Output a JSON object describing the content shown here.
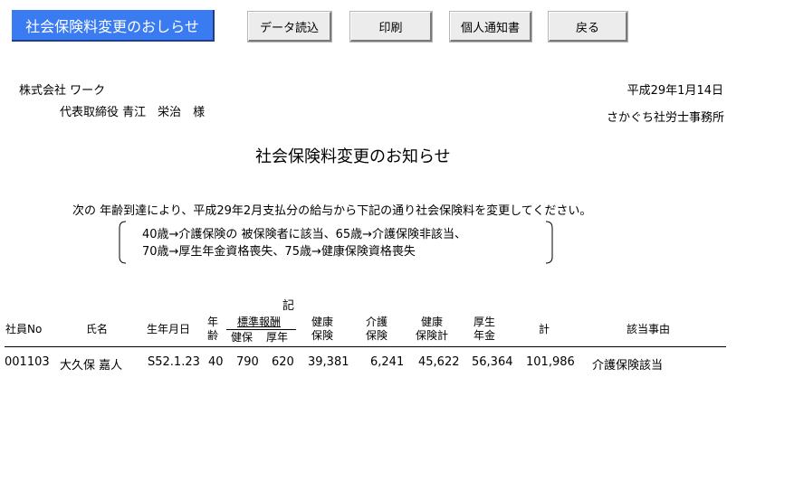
{
  "toolbar": {
    "title_badge": "社会保険料変更のおしらせ",
    "buttons": {
      "data_load": "データ読込",
      "print": "印刷",
      "individual_notice": "個人通知書",
      "back": "戻る"
    }
  },
  "letter": {
    "recipient_company": "株式会社 ワーク",
    "recipient_person": "代表取締役 青江　栄治　様",
    "date": "平成29年1月14日",
    "sender": "さかぐち社労士事務所",
    "title": "社会保険料変更のお知らせ",
    "intro": "次の 年齢到達により、平成29年2月支払分の給与から下記の通り社会保険料を変更してください。",
    "note_line1": "40歳→介護保険の 被保険者に該当、65歳→介護保険非該当、",
    "note_line2": "70歳→厚生年金資格喪失、75歳→健康保険資格喪失",
    "ki": "記"
  },
  "table": {
    "headers": {
      "employee_no": "社員No",
      "name": "氏名",
      "birth_date": "生年月日",
      "age_1": "年",
      "age_2": "齢",
      "std_remuneration": "標準報酬",
      "std_health": "健保",
      "std_pension": "厚年",
      "health_ins_1": "健康",
      "health_ins_2": "保険",
      "care_ins_1": "介護",
      "care_ins_2": "保険",
      "health_total_1": "健康",
      "health_total_2": "保険計",
      "pension_1": "厚生",
      "pension_2": "年金",
      "total": "計",
      "reason": "該当事由"
    },
    "rows": [
      {
        "employee_no": "001103",
        "name": "大久保 嘉人",
        "birth_date": "S52.1.23",
        "age": "40",
        "std_health": "790",
        "std_pension": "620",
        "health_ins": "39,381",
        "care_ins": "6,241",
        "health_total": "45,622",
        "pension": "56,364",
        "total": "101,986",
        "reason": "介護保険該当"
      }
    ]
  }
}
